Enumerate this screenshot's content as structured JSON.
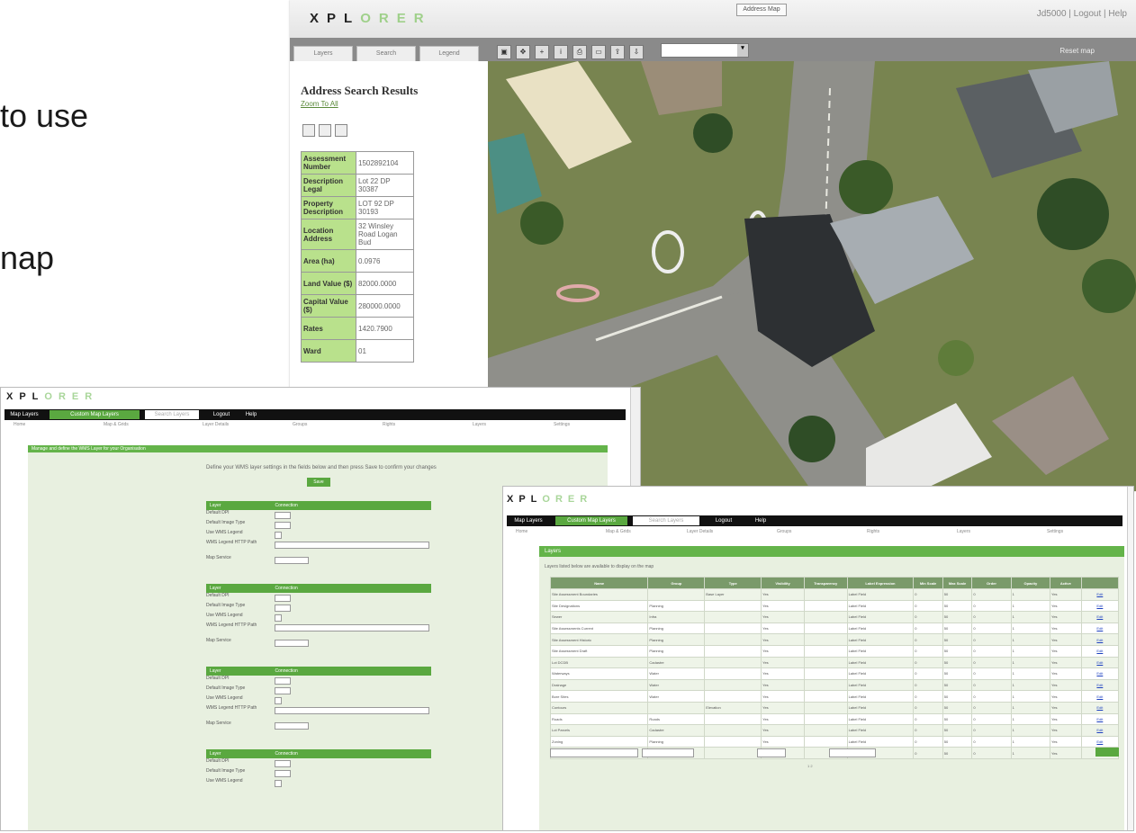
{
  "slide": {
    "line1": "to use",
    "line2": "nap"
  },
  "map_window": {
    "logo_first": "XPL",
    "logo_rest": "ORER",
    "address_map_button": "Address Map",
    "top_links": "Jd5000 | Logout | Help",
    "tabs": [
      "Layers",
      "Search",
      "Legend"
    ],
    "toolbar_icons": [
      "zoom-to-extent-icon",
      "pan-icon",
      "zoom-in-icon",
      "info-icon",
      "print-icon",
      "measure-icon",
      "export-icon",
      "download-icon"
    ],
    "reset_link": "Reset map",
    "panel": {
      "title": "Address Search Results",
      "subtitle": "Zoom To All",
      "attributes": [
        {
          "key": "Assessment Number",
          "value": "1502892104"
        },
        {
          "key": "Description Legal",
          "value": "Lot 22 DP 30387"
        },
        {
          "key": "Property Description",
          "value": "LOT 92 DP 30193"
        },
        {
          "key": "Location Address",
          "value": "32 Winsley Road Logan Bud"
        },
        {
          "key": "Area (ha)",
          "value": "0.0976"
        },
        {
          "key": "Land Value ($)",
          "value": "82000.0000"
        },
        {
          "key": "Capital Value ($)",
          "value": "280000.0000"
        },
        {
          "key": "Rates",
          "value": "1420.7900"
        },
        {
          "key": "Ward",
          "value": "01"
        }
      ]
    }
  },
  "form_window": {
    "logo_first": "XPL",
    "logo_rest": "ORER",
    "nav": [
      "Map Layers",
      "Custom Map Layers",
      "Search Layers",
      "Logout",
      "Help"
    ],
    "links": [
      "Home",
      "Map & Grids",
      "Layer Details",
      "Groups",
      "Rights",
      "Layers",
      "Settings"
    ],
    "header": "Manage and define the WMS Layer for your Organisation",
    "intro": "Define your WMS layer settings in the fields below and then press Save to confirm your changes",
    "search_button": "Save",
    "sections": [
      {
        "title": "Layer",
        "right": "Connection",
        "rows": [
          "Default DPI",
          "Default Image Type",
          "Use WMS Legend",
          "WMS Legend HTTP Path",
          "Map Service"
        ]
      },
      {
        "title": "Layer",
        "right": "Connection",
        "rows": [
          "Default DPI",
          "Default Image Type",
          "Use WMS Legend",
          "WMS Legend HTTP Path",
          "Map Service"
        ]
      },
      {
        "title": "Layer",
        "right": "Connection",
        "rows": [
          "Default DPI",
          "Default Image Type",
          "Use WMS Legend",
          "WMS Legend HTTP Path",
          "Map Service"
        ]
      },
      {
        "title": "Layer",
        "right": "Connection",
        "rows": [
          "Default DPI",
          "Default Image Type",
          "Use WMS Legend"
        ]
      }
    ]
  },
  "grid_window": {
    "logo_first": "XPL",
    "logo_rest": "ORER",
    "nav": [
      "Map Layers",
      "Custom Map Layers",
      "Search Layers",
      "Logout",
      "Help"
    ],
    "links": [
      "Home",
      "Map & Grids",
      "Layer Details",
      "Groups",
      "Rights",
      "Layers",
      "Settings"
    ],
    "header": "Layers",
    "intro": "Layers listed below are available to display on the map",
    "columns": [
      "Name",
      "Group",
      "Type",
      "Visibility",
      "Transparency",
      "Label Expression",
      "Min Scale",
      "Max Scale",
      "Order",
      "Opacity",
      "Active",
      ""
    ],
    "rows": [
      [
        "Site Assessment Boundaries",
        "",
        "Base Layer",
        "Yes",
        "",
        "Label Field",
        "0",
        "50",
        "0",
        "1",
        "Yes",
        "Edit"
      ],
      [
        "Site Designations",
        "Planning",
        "",
        "Yes",
        "",
        "Label Field",
        "0",
        "50",
        "0",
        "1",
        "Yes",
        "Edit"
      ],
      [
        "Sewer",
        "Infra",
        "",
        "Yes",
        "",
        "Label Field",
        "0",
        "50",
        "0",
        "1",
        "Yes",
        "Edit"
      ],
      [
        "Site Assessments Current",
        "Planning",
        "",
        "Yes",
        "",
        "Label Field",
        "0",
        "50",
        "0",
        "1",
        "Yes",
        "Edit"
      ],
      [
        "Site Assessment Historic",
        "Planning",
        "",
        "Yes",
        "",
        "Label Field",
        "0",
        "50",
        "0",
        "1",
        "Yes",
        "Edit"
      ],
      [
        "Site Assessment Draft",
        "Planning",
        "",
        "Yes",
        "",
        "Label Field",
        "0",
        "50",
        "0",
        "1",
        "Yes",
        "Edit"
      ],
      [
        "Lot DCDB",
        "Cadastre",
        "",
        "Yes",
        "",
        "Label Field",
        "0",
        "50",
        "0",
        "1",
        "Yes",
        "Edit"
      ],
      [
        "Waterways",
        "Water",
        "",
        "Yes",
        "",
        "Label Field",
        "0",
        "50",
        "0",
        "1",
        "Yes",
        "Edit"
      ],
      [
        "Drainage",
        "Water",
        "",
        "Yes",
        "",
        "Label Field",
        "0",
        "50",
        "0",
        "1",
        "Yes",
        "Edit"
      ],
      [
        "Bore Sites",
        "Water",
        "",
        "Yes",
        "",
        "Label Field",
        "0",
        "50",
        "0",
        "1",
        "Yes",
        "Edit"
      ],
      [
        "Contours",
        "",
        "Elevation",
        "Yes",
        "",
        "Label Field",
        "0",
        "50",
        "0",
        "1",
        "Yes",
        "Edit"
      ],
      [
        "Roads",
        "Roads",
        "",
        "Yes",
        "",
        "Label Field",
        "0",
        "50",
        "0",
        "1",
        "Yes",
        "Edit"
      ],
      [
        "Lot Parcels",
        "Cadastre",
        "",
        "Yes",
        "",
        "Label Field",
        "0",
        "50",
        "0",
        "1",
        "Yes",
        "Edit"
      ],
      [
        "Zoning",
        "Planning",
        "",
        "Yes",
        "",
        "Label Field",
        "0",
        "50",
        "0",
        "1",
        "Yes",
        "Edit"
      ],
      [
        "Site Assessment Zones",
        "Planning",
        "",
        "Yes",
        "",
        "Label Field",
        "0",
        "50",
        "0",
        "1",
        "Yes",
        "Edit"
      ]
    ],
    "pagination": "1 2"
  }
}
